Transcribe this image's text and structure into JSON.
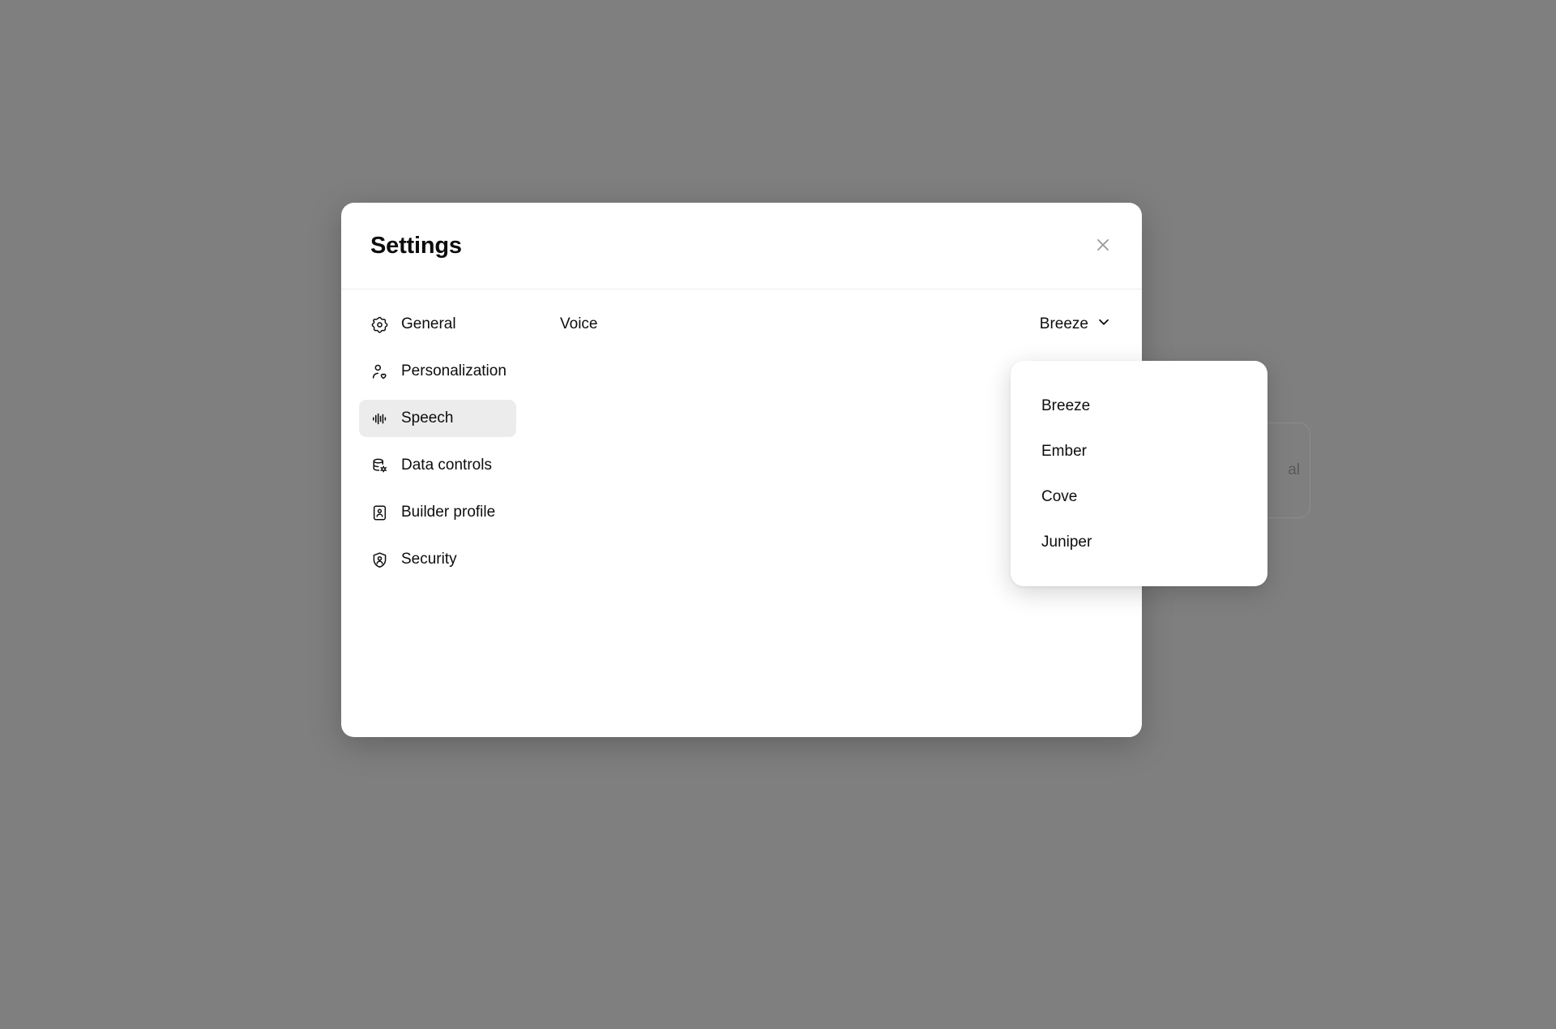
{
  "background": {
    "color": "#7f7f7f",
    "obscured_card_text": "al"
  },
  "modal": {
    "title": "Settings",
    "close_icon": "close-icon",
    "close_label": "Close"
  },
  "sidebar": {
    "items": [
      {
        "label": "General",
        "icon": "gear-icon",
        "active": false
      },
      {
        "label": "Personalization",
        "icon": "person-heart-icon",
        "active": false
      },
      {
        "label": "Speech",
        "icon": "waveform-icon",
        "active": true
      },
      {
        "label": "Data controls",
        "icon": "database-gear-icon",
        "active": false
      },
      {
        "label": "Builder profile",
        "icon": "id-card-icon",
        "active": false
      },
      {
        "label": "Security",
        "icon": "shield-person-icon",
        "active": false
      }
    ]
  },
  "content": {
    "voice_row": {
      "label": "Voice",
      "selected_value": "Breeze",
      "chevron_icon": "chevron-down-icon"
    }
  },
  "dropdown": {
    "open": true,
    "options": [
      {
        "label": "Breeze"
      },
      {
        "label": "Ember"
      },
      {
        "label": "Cove"
      },
      {
        "label": "Juniper"
      }
    ]
  },
  "colors": {
    "backdrop": "#7f7f7f",
    "surface": "#ffffff",
    "text": "#0d0d0d",
    "active_item_bg": "#ececec",
    "divider": "#ececec",
    "muted_icon": "#9b9b9b"
  }
}
